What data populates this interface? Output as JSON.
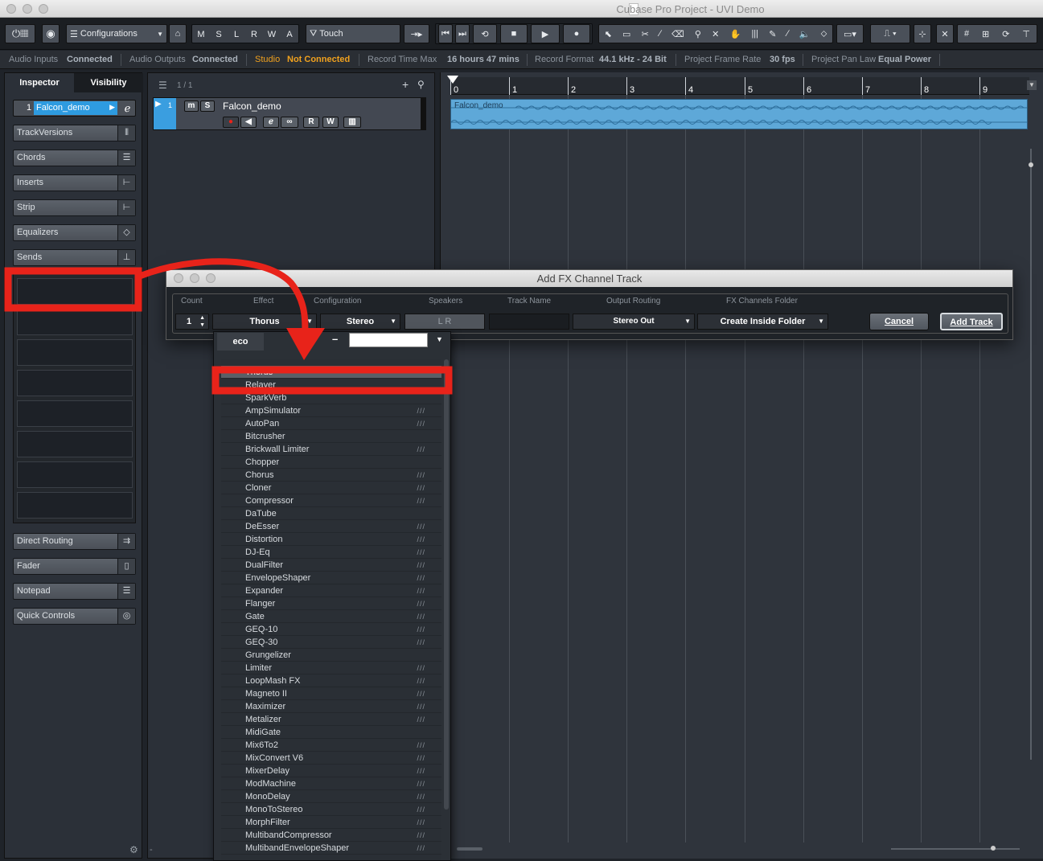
{
  "window": {
    "title": "Cubase Pro Project - UVI Demo"
  },
  "toolbar": {
    "configurations_label": "Configurations",
    "mslrwa": [
      "M",
      "S",
      "L",
      "R",
      "W",
      "A"
    ],
    "automation_mode": "Touch"
  },
  "status_line": {
    "audio_inputs_key": "Audio Inputs",
    "audio_inputs_val": "Connected",
    "audio_outputs_key": "Audio Outputs",
    "audio_outputs_val": "Connected",
    "studio_key": "Studio",
    "studio_val": "Not Connected",
    "record_time_key": "Record Time Max",
    "record_time_val": "16 hours 47 mins",
    "record_format_key": "Record Format",
    "record_format_val": "44.1 kHz - 24 Bit",
    "frame_rate_key": "Project Frame Rate",
    "frame_rate_val": "30 fps",
    "pan_law_key": "Project Pan Law",
    "pan_law_val": "Equal Power"
  },
  "inspector": {
    "tabs": [
      "Inspector",
      "Visibility"
    ],
    "track_number": "1",
    "track_name": "Falcon_demo",
    "sections": [
      "TrackVersions",
      "Chords",
      "Inserts",
      "Strip",
      "Equalizers",
      "Sends"
    ],
    "sections_bottom": [
      "Direct Routing",
      "Fader",
      "Notepad",
      "Quick Controls"
    ]
  },
  "tracklist": {
    "count": "1 / 1",
    "track_number": "1",
    "track_name": "Falcon_demo",
    "buttons": [
      "m",
      "S",
      "R",
      "W"
    ]
  },
  "project": {
    "bars": [
      "0",
      "1",
      "2",
      "3",
      "4",
      "5",
      "6",
      "7",
      "8",
      "9"
    ],
    "event_name": "Falcon_demo"
  },
  "dialog": {
    "title": "Add FX Channel Track",
    "headers": [
      "Count",
      "Effect",
      "Configuration",
      "Speakers",
      "Track Name",
      "Output Routing",
      "FX Channels Folder"
    ],
    "count": "1",
    "effect": "Thorus",
    "configuration": "Stereo",
    "speakers": "L R",
    "track_name": "",
    "output_routing": "Stereo Out",
    "folder": "Create Inside Folder",
    "cancel": "Cancel",
    "add_track": "Add Track"
  },
  "dropdown": {
    "tab": "eco",
    "search_value": "",
    "items": [
      {
        "label": "Thorus",
        "mark": "",
        "selected": true
      },
      {
        "label": "Relayer",
        "mark": ""
      },
      {
        "label": "SparkVerb",
        "mark": ""
      },
      {
        "label": "AmpSimulator",
        "mark": "///"
      },
      {
        "label": "AutoPan",
        "mark": "///"
      },
      {
        "label": "Bitcrusher",
        "mark": ""
      },
      {
        "label": "Brickwall Limiter",
        "mark": "///"
      },
      {
        "label": "Chopper",
        "mark": ""
      },
      {
        "label": "Chorus",
        "mark": "///"
      },
      {
        "label": "Cloner",
        "mark": "///"
      },
      {
        "label": "Compressor",
        "mark": "///"
      },
      {
        "label": "DaTube",
        "mark": ""
      },
      {
        "label": "DeEsser",
        "mark": "///"
      },
      {
        "label": "Distortion",
        "mark": "///"
      },
      {
        "label": "DJ-Eq",
        "mark": "///"
      },
      {
        "label": "DualFilter",
        "mark": "///"
      },
      {
        "label": "EnvelopeShaper",
        "mark": "///"
      },
      {
        "label": "Expander",
        "mark": "///"
      },
      {
        "label": "Flanger",
        "mark": "///"
      },
      {
        "label": "Gate",
        "mark": "///"
      },
      {
        "label": "GEQ-10",
        "mark": "///"
      },
      {
        "label": "GEQ-30",
        "mark": "///"
      },
      {
        "label": "Grungelizer",
        "mark": ""
      },
      {
        "label": "Limiter",
        "mark": "///"
      },
      {
        "label": "LoopMash FX",
        "mark": "///"
      },
      {
        "label": "Magneto II",
        "mark": "///"
      },
      {
        "label": "Maximizer",
        "mark": "///"
      },
      {
        "label": "Metalizer",
        "mark": "///"
      },
      {
        "label": "MidiGate",
        "mark": ""
      },
      {
        "label": "Mix6To2",
        "mark": "///"
      },
      {
        "label": "MixConvert V6",
        "mark": "///"
      },
      {
        "label": "MixerDelay",
        "mark": "///"
      },
      {
        "label": "ModMachine",
        "mark": "///"
      },
      {
        "label": "MonoDelay",
        "mark": "///"
      },
      {
        "label": "MonoToStereo",
        "mark": "///"
      },
      {
        "label": "MorphFilter",
        "mark": "///"
      },
      {
        "label": "MultibandCompressor",
        "mark": "///"
      },
      {
        "label": "MultibandEnvelopeShaper",
        "mark": "///"
      }
    ]
  },
  "colors": {
    "accent_blue": "#5ea8d8",
    "annotation_red": "#e8231a",
    "status_orange": "#f0a11e"
  }
}
